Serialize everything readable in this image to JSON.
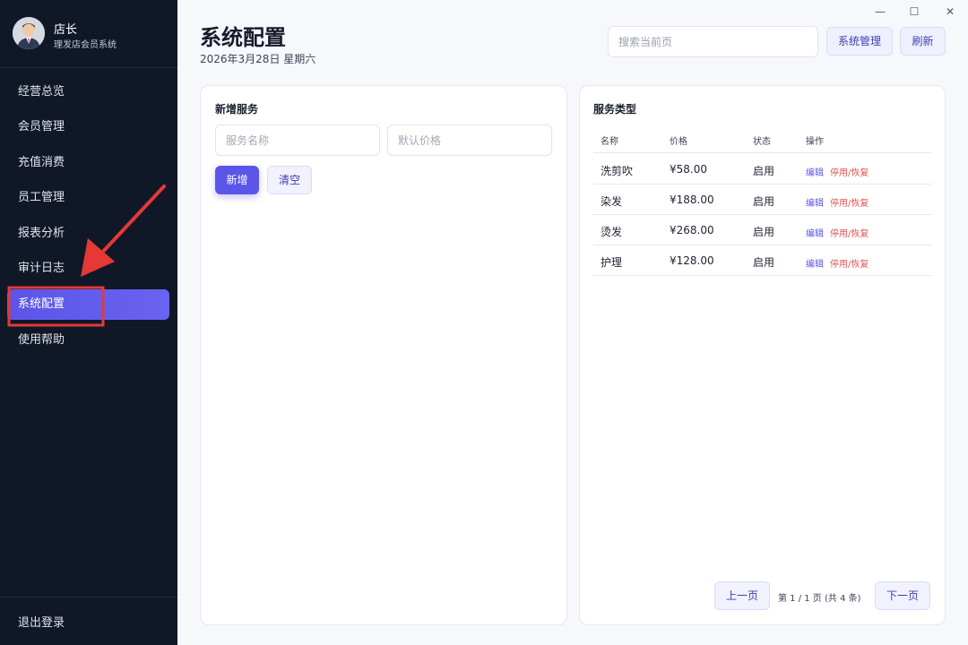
{
  "window": {
    "minimize": "—",
    "maximize": "☐",
    "close": "✕"
  },
  "sidebar": {
    "user_name": "店长",
    "user_subtitle": "理发店会员系统",
    "items": [
      {
        "label": "经营总览"
      },
      {
        "label": "会员管理"
      },
      {
        "label": "充值消费"
      },
      {
        "label": "员工管理"
      },
      {
        "label": "报表分析"
      },
      {
        "label": "审计日志"
      },
      {
        "label": "系统配置",
        "active": true
      },
      {
        "label": "使用帮助"
      }
    ],
    "logout_label": "退出登录"
  },
  "header": {
    "title": "系统配置",
    "date": "2026年3月28日 星期六",
    "search_placeholder": "搜索当前页",
    "system_manage_label": "系统管理",
    "refresh_label": "刷新"
  },
  "add_service": {
    "title": "新增服务",
    "name_placeholder": "服务名称",
    "price_placeholder": "默认价格",
    "add_label": "新增",
    "clear_label": "清空"
  },
  "service_types": {
    "title": "服务类型",
    "columns": [
      "名称",
      "价格",
      "状态",
      "操作"
    ],
    "rows": [
      {
        "name": "洗剪吹",
        "price": "¥58.00",
        "status": "启用",
        "edit": "编辑",
        "toggle": "停用/恢复"
      },
      {
        "name": "染发",
        "price": "¥188.00",
        "status": "启用",
        "edit": "编辑",
        "toggle": "停用/恢复"
      },
      {
        "name": "烫发",
        "price": "¥268.00",
        "status": "启用",
        "edit": "编辑",
        "toggle": "停用/恢复"
      },
      {
        "name": "护理",
        "price": "¥128.00",
        "status": "启用",
        "edit": "编辑",
        "toggle": "停用/恢复"
      }
    ],
    "prev_label": "上一页",
    "page_info": "第 1 / 1 页 (共 4 条)",
    "next_label": "下一页"
  },
  "colors": {
    "sidebar_bg": "#101828",
    "accent": "#5b55e8",
    "danger_link": "#e05555",
    "annotation": "#e53935"
  }
}
